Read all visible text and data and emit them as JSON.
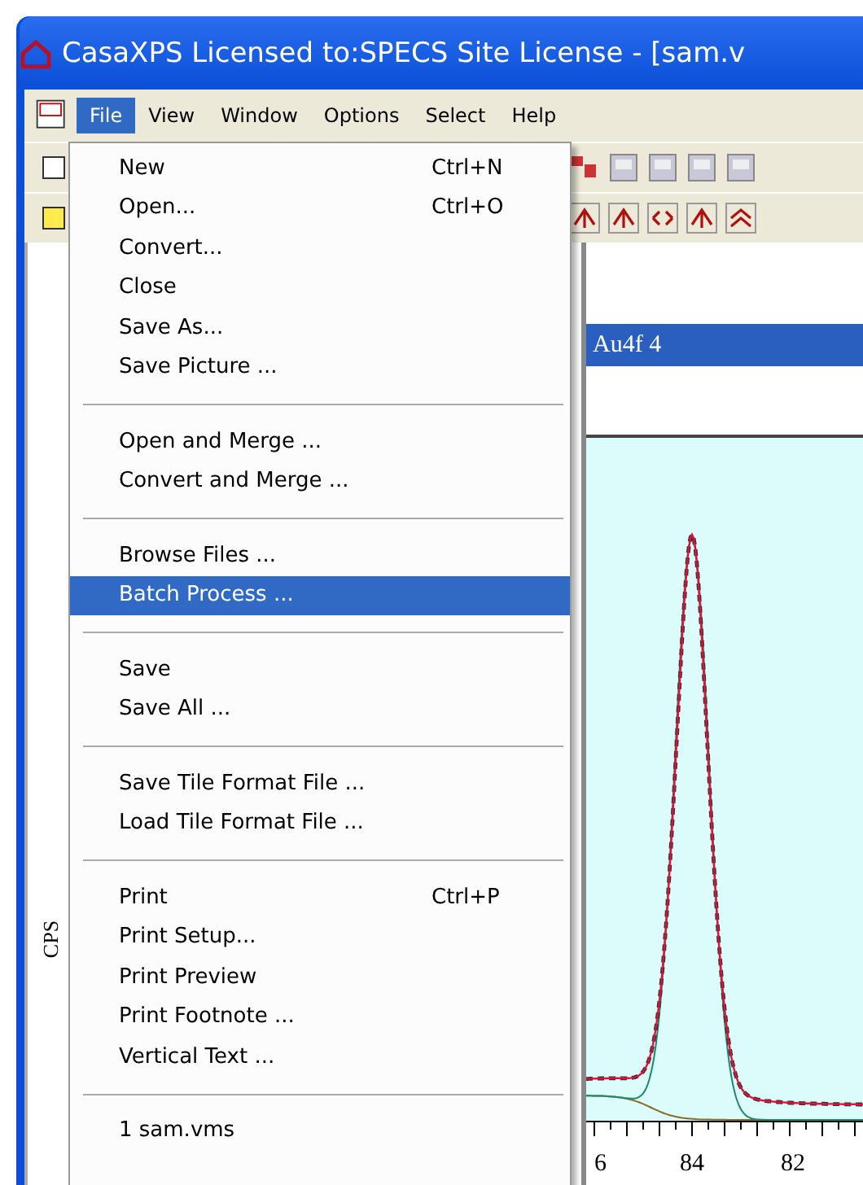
{
  "window": {
    "title": "CasaXPS Licensed to:SPECS Site License - [sam.v"
  },
  "menubar": [
    {
      "label": "File",
      "selected": true
    },
    {
      "label": "View",
      "selected": false
    },
    {
      "label": "Window",
      "selected": false
    },
    {
      "label": "Options",
      "selected": false
    },
    {
      "label": "Select",
      "selected": false
    },
    {
      "label": "Help",
      "selected": false
    }
  ],
  "file_menu": [
    {
      "kind": "item",
      "label": "New",
      "shortcut": "Ctrl+N",
      "selected": false
    },
    {
      "kind": "item",
      "label": "Open...",
      "shortcut": "Ctrl+O",
      "selected": false
    },
    {
      "kind": "item",
      "label": "Convert...",
      "selected": false
    },
    {
      "kind": "item",
      "label": "Close",
      "selected": false
    },
    {
      "kind": "item",
      "label": "Save As...",
      "selected": false
    },
    {
      "kind": "item",
      "label": "Save Picture ...",
      "selected": false
    },
    {
      "kind": "separator"
    },
    {
      "kind": "item",
      "label": "Open and Merge ...",
      "selected": false
    },
    {
      "kind": "item",
      "label": "Convert and Merge ...",
      "selected": false
    },
    {
      "kind": "separator"
    },
    {
      "kind": "item",
      "label": "Browse Files ...",
      "selected": false
    },
    {
      "kind": "item",
      "label": "Batch Process ...",
      "selected": true
    },
    {
      "kind": "separator"
    },
    {
      "kind": "item",
      "label": "Save",
      "selected": false
    },
    {
      "kind": "item",
      "label": "Save All ...",
      "selected": false
    },
    {
      "kind": "separator"
    },
    {
      "kind": "item",
      "label": "Save Tile Format File ...",
      "selected": false
    },
    {
      "kind": "item",
      "label": "Load Tile Format File ...",
      "selected": false
    },
    {
      "kind": "separator"
    },
    {
      "kind": "item",
      "label": "Print",
      "shortcut": "Ctrl+P",
      "selected": false
    },
    {
      "kind": "item",
      "label": "Print Setup...",
      "selected": false
    },
    {
      "kind": "item",
      "label": "Print Preview",
      "selected": false
    },
    {
      "kind": "item",
      "label": "Print Footnote ...",
      "selected": false
    },
    {
      "kind": "item",
      "label": "Vertical Text ...",
      "selected": false
    },
    {
      "kind": "separator"
    },
    {
      "kind": "item",
      "label": "1 sam.vms",
      "selected": false
    }
  ],
  "plot": {
    "title": "Au4f 4",
    "ylabel": "CPS",
    "x_tick_labels": [
      "6",
      "84",
      "82"
    ]
  }
}
